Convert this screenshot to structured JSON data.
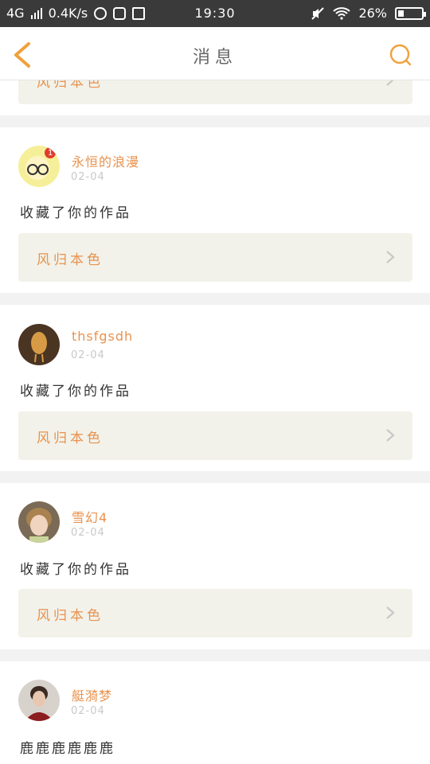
{
  "status_bar": {
    "network": "4G",
    "speed": "0.4K/s",
    "time": "19:30",
    "battery": "26%",
    "battery_level": 0.26
  },
  "nav": {
    "title": "消息",
    "back_icon": "chevron-left-icon",
    "search_icon": "search-icon",
    "accent": "#f0a03c"
  },
  "messages": [
    {
      "user": "永恒的浪漫",
      "date": "02-04",
      "text": "收藏了你的作品",
      "work_title": "风归本色",
      "avatar_badge": "1"
    },
    {
      "user": "thsfgsdh",
      "date": "02-04",
      "text": "收藏了你的作品",
      "work_title": "风归本色"
    },
    {
      "user": "雪幻4",
      "date": "02-04",
      "text": "收藏了你的作品",
      "work_title": "风归本色"
    },
    {
      "user": "艇漪梦",
      "date": "02-04",
      "text": "鹿鹿鹿鹿鹿鹿"
    }
  ],
  "partial_top_item": {
    "work_title": "风归本色"
  }
}
